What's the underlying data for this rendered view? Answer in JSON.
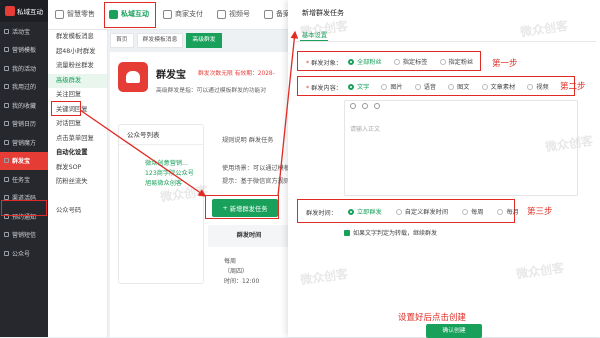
{
  "sidebar": {
    "brand": "私域互动",
    "items": [
      {
        "label": "活动宝",
        "active": false
      },
      {
        "label": "营销模板",
        "active": false
      },
      {
        "label": "我的活动",
        "active": false
      },
      {
        "label": "我用过的",
        "active": false
      },
      {
        "label": "我的收藏",
        "active": false
      },
      {
        "label": "营销日历",
        "active": false
      },
      {
        "label": "营销魔方",
        "active": false
      },
      {
        "label": "群发宝",
        "active": true
      },
      {
        "label": "任务宝",
        "active": false
      },
      {
        "label": "渠道活码",
        "active": false
      },
      {
        "label": "预约通知",
        "active": false
      },
      {
        "label": "营销短信",
        "active": false
      },
      {
        "label": "公众号",
        "active": false
      }
    ]
  },
  "topnav": {
    "tabs": [
      {
        "label": "智慧零售",
        "active": false
      },
      {
        "label": "私域互动",
        "active": true
      },
      {
        "label": "商家支付",
        "active": false
      },
      {
        "label": "视频号",
        "active": false
      },
      {
        "label": "备案中心",
        "active": false
      }
    ]
  },
  "submenu": {
    "items": [
      {
        "label": "群发模板消息",
        "type": "item"
      },
      {
        "label": "超48小时群发",
        "type": "item"
      },
      {
        "label": "流量粉丝群发",
        "type": "item"
      },
      {
        "label": "高级群发",
        "type": "active"
      },
      {
        "label": "关注回复",
        "type": "item"
      },
      {
        "label": "关键词回复",
        "type": "item"
      },
      {
        "label": "对话回复",
        "type": "item"
      },
      {
        "label": "点击菜单回复",
        "type": "item"
      },
      {
        "label": "自动化设置",
        "type": "grp"
      },
      {
        "label": "群发SOP",
        "type": "item"
      },
      {
        "label": "防粉丝流失",
        "type": "item"
      },
      {
        "label": "",
        "type": "item"
      },
      {
        "label": "公众号码",
        "type": "item"
      }
    ]
  },
  "crumbs": [
    {
      "label": "首页",
      "on": false
    },
    {
      "label": "群发模板消息",
      "on": false
    },
    {
      "label": "高级群发",
      "on": true
    }
  ],
  "hero": {
    "title": "群发宝",
    "remain": "群发次数无限  有效期：2028-",
    "desc": "高级群发是指：可以通过模板群发的功能对"
  },
  "left_card": {
    "title": "公众号列表",
    "lines": [
      "微众创意营销...",
      "123商学院公众号",
      "旭易微众创客"
    ]
  },
  "right_card": {
    "tabs_line": "规则说明     群发任务",
    "rule1": "使用场景：可以通过模板",
    "rule2": "提示：基于微信官方规则",
    "new_task": "新增群发任务",
    "table_header": "群发时间",
    "row_freq": "每周",
    "row_day": "（周四）",
    "row_time_label": "时间：12:00"
  },
  "modal": {
    "title": "新增群发任务",
    "tab": "基本设置",
    "audience_label": "群发对象：",
    "audience_options": [
      {
        "label": "全部粉丝",
        "selected": true
      },
      {
        "label": "指定标签",
        "selected": false
      },
      {
        "label": "指定粉丝",
        "selected": false
      }
    ],
    "content_label": "群发内容：",
    "content_options": [
      {
        "label": "文字",
        "selected": true
      },
      {
        "label": "图片",
        "selected": false
      },
      {
        "label": "语音",
        "selected": false
      },
      {
        "label": "图文",
        "selected": false
      },
      {
        "label": "文章素材",
        "selected": false
      },
      {
        "label": "视频",
        "selected": false
      }
    ],
    "editor_placeholder": "请输入正文",
    "time_label": "群发时间：",
    "time_options": [
      {
        "label": "立即群发",
        "selected": true
      },
      {
        "label": "自定义群发时间",
        "selected": false
      },
      {
        "label": "每周",
        "selected": false
      },
      {
        "label": "每月",
        "selected": false
      }
    ],
    "checkbox_text": "如果文字判定为转载，继续群发",
    "confirm": "确认创建"
  },
  "annotations": {
    "step1": "第一步",
    "step2": "第二步",
    "step3": "第三步",
    "hint": "设置好后点击创建"
  },
  "watermark": "微众创客"
}
